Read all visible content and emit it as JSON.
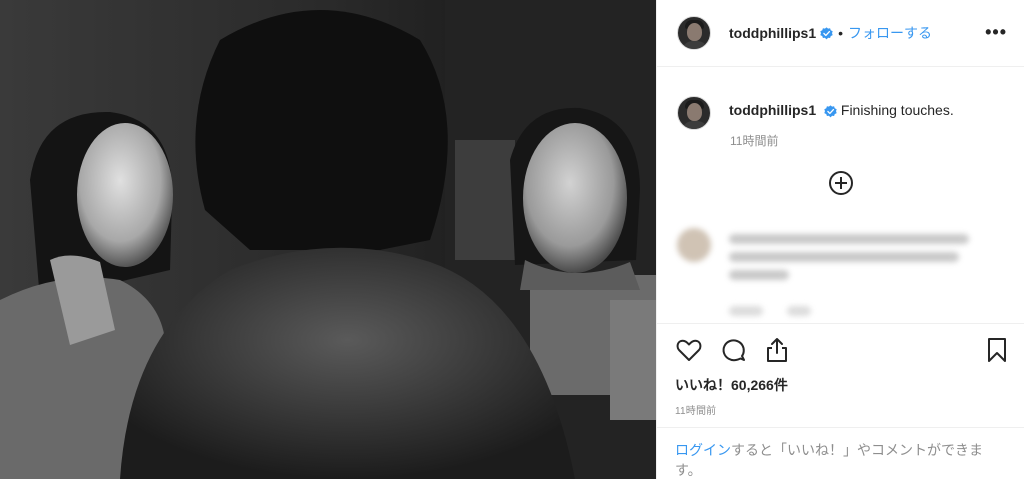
{
  "post": {
    "username": "toddphillips1",
    "follow_separator": "•",
    "follow_label": "フォローする",
    "more_label": "•••",
    "caption_text": "Finishing touches.",
    "caption_time": "11時間前",
    "likes_label": "いいね！60,266件",
    "post_time": "11時間前",
    "login_link": "ログイン",
    "login_rest": "すると「いいね！」やコメントができます。"
  },
  "icons": {
    "verified": "verified-badge-icon",
    "load_more": "plus-circle-icon",
    "like": "heart-icon",
    "comment": "comment-bubble-icon",
    "share": "share-icon",
    "save": "bookmark-icon",
    "more": "ellipsis-icon"
  },
  "colors": {
    "accent": "#3897f0",
    "text": "#262626",
    "muted": "#8e8e8e",
    "border": "#efefef"
  }
}
